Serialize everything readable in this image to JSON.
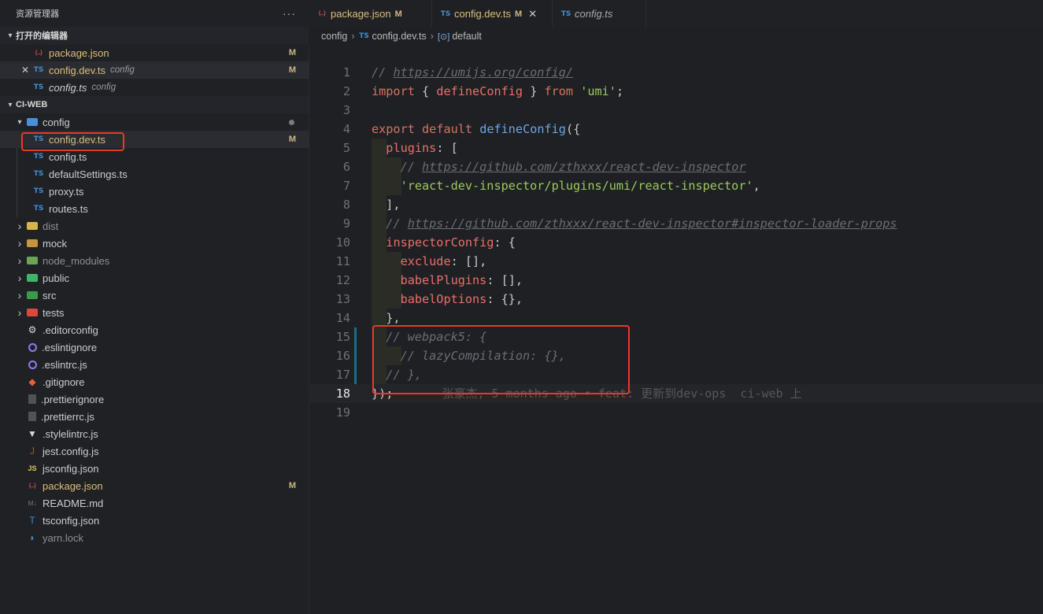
{
  "explorer": {
    "title": "资源管理器",
    "more": "···",
    "open_editors_title": "打开的编辑器",
    "project_title": "CI-WEB",
    "open_editors": [
      {
        "name": "package.json",
        "desc": "",
        "badge": "M",
        "icon": "json-icon",
        "close": ""
      },
      {
        "name": "config.dev.ts",
        "desc": "config",
        "badge": "M",
        "icon": "ts-icon",
        "close": "✕"
      },
      {
        "name": "config.ts",
        "desc": "config",
        "badge": "",
        "icon": "ts-icon",
        "close": ""
      }
    ],
    "tree": [
      {
        "name": "config",
        "type": "folder",
        "open": true,
        "icon_color": "#4a90d9",
        "status": "dot"
      },
      {
        "name": "config.dev.ts",
        "type": "ts",
        "badge": "M"
      },
      {
        "name": "config.ts",
        "type": "ts"
      },
      {
        "name": "defaultSettings.ts",
        "type": "ts"
      },
      {
        "name": "proxy.ts",
        "type": "ts"
      },
      {
        "name": "routes.ts",
        "type": "ts"
      },
      {
        "name": "dist",
        "type": "folder",
        "icon_color": "#d9b44a"
      },
      {
        "name": "mock",
        "type": "folder",
        "icon_color": "#c7953f"
      },
      {
        "name": "node_modules",
        "type": "folder",
        "icon_color": "#6ea45a"
      },
      {
        "name": "public",
        "type": "folder",
        "icon_color": "#3fb56a"
      },
      {
        "name": "src",
        "type": "folder",
        "icon_color": "#3a9a4a"
      },
      {
        "name": "tests",
        "type": "folder",
        "icon_color": "#d94a3a"
      },
      {
        "name": ".editorconfig",
        "type": "file"
      },
      {
        "name": ".eslintignore",
        "type": "file"
      },
      {
        "name": ".eslintrc.js",
        "type": "file"
      },
      {
        "name": ".gitignore",
        "type": "file"
      },
      {
        "name": ".prettierignore",
        "type": "file"
      },
      {
        "name": ".prettierrc.js",
        "type": "file"
      },
      {
        "name": ".stylelintrc.js",
        "type": "file"
      },
      {
        "name": "jest.config.js",
        "type": "file"
      },
      {
        "name": "jsconfig.json",
        "type": "js"
      },
      {
        "name": "package.json",
        "type": "json",
        "badge": "M"
      },
      {
        "name": "README.md",
        "type": "file"
      },
      {
        "name": "tsconfig.json",
        "type": "file"
      },
      {
        "name": "yarn.lock",
        "type": "file"
      }
    ]
  },
  "tabs": [
    {
      "label": "package.json",
      "icon": "json-icon",
      "modified": "M",
      "active": false,
      "italic": false
    },
    {
      "label": "config.dev.ts",
      "icon": "ts-icon",
      "modified": "M",
      "active": true,
      "italic": false,
      "close": "✕"
    },
    {
      "label": "config.ts",
      "icon": "ts-icon",
      "modified": "",
      "active": false,
      "italic": true
    }
  ],
  "icons": {
    "ts": "TS",
    "js": "JS",
    "json": "{...}"
  },
  "breadcrumb": {
    "folder": "config",
    "file": "config.dev.ts",
    "symbol_icon": "[⊙]",
    "symbol": "default"
  },
  "editor": {
    "blame": "张豪杰, 5 months ago • feat: 更新到dev-ops  ci-web 上",
    "lines": [
      {
        "n": "1",
        "tokens": [
          [
            "c-comment",
            "// "
          ],
          [
            "c-comment c-url",
            "https://umijs.org/config/"
          ]
        ]
      },
      {
        "n": "2",
        "tokens": [
          [
            "c-kw",
            "import"
          ],
          [
            "c-punc",
            " { "
          ],
          [
            "c-prop",
            "defineConfig"
          ],
          [
            "c-punc",
            " } "
          ],
          [
            "c-kw",
            "from"
          ],
          [
            "c-punc",
            " "
          ],
          [
            "c-str",
            "'umi'"
          ],
          [
            "c-punc",
            ";"
          ]
        ]
      },
      {
        "n": "3",
        "tokens": []
      },
      {
        "n": "4",
        "tokens": [
          [
            "c-kw",
            "export"
          ],
          [
            "c-punc",
            " "
          ],
          [
            "c-kw",
            "default"
          ],
          [
            "c-punc",
            " "
          ],
          [
            "c-fn",
            "defineConfig"
          ],
          [
            "c-punc",
            "({"
          ]
        ]
      },
      {
        "n": "5",
        "tokens": [
          [
            "c-punc",
            "  "
          ],
          [
            "c-prop",
            "plugins"
          ],
          [
            "c-punc",
            ": ["
          ]
        ]
      },
      {
        "n": "6",
        "tokens": [
          [
            "c-punc",
            "    "
          ],
          [
            "c-comment",
            "// "
          ],
          [
            "c-comment c-url",
            "https://github.com/zthxxx/react-dev-inspector"
          ]
        ]
      },
      {
        "n": "7",
        "tokens": [
          [
            "c-punc",
            "    "
          ],
          [
            "c-str",
            "'react-dev-inspector/plugins/umi/react-inspector'"
          ],
          [
            "c-punc",
            ","
          ]
        ]
      },
      {
        "n": "8",
        "tokens": [
          [
            "c-punc",
            "  ],"
          ]
        ]
      },
      {
        "n": "9",
        "tokens": [
          [
            "c-punc",
            "  "
          ],
          [
            "c-comment",
            "// "
          ],
          [
            "c-comment c-url",
            "https://github.com/zthxxx/react-dev-inspector#inspector-loader-props"
          ]
        ]
      },
      {
        "n": "10",
        "tokens": [
          [
            "c-punc",
            "  "
          ],
          [
            "c-prop",
            "inspectorConfig"
          ],
          [
            "c-punc",
            ": {"
          ]
        ]
      },
      {
        "n": "11",
        "tokens": [
          [
            "c-punc",
            "    "
          ],
          [
            "c-prop",
            "exclude"
          ],
          [
            "c-punc",
            ": [],"
          ]
        ]
      },
      {
        "n": "12",
        "tokens": [
          [
            "c-punc",
            "    "
          ],
          [
            "c-prop",
            "babelPlugins"
          ],
          [
            "c-punc",
            ": [],"
          ]
        ]
      },
      {
        "n": "13",
        "tokens": [
          [
            "c-punc",
            "    "
          ],
          [
            "c-prop",
            "babelOptions"
          ],
          [
            "c-punc",
            ": {},"
          ]
        ]
      },
      {
        "n": "14",
        "tokens": [
          [
            "c-punc",
            "  },"
          ]
        ]
      },
      {
        "n": "15",
        "tokens": [
          [
            "c-punc",
            "  "
          ],
          [
            "c-comment",
            "// webpack5: {"
          ]
        ]
      },
      {
        "n": "16",
        "tokens": [
          [
            "c-punc",
            "    "
          ],
          [
            "c-comment",
            "// lazyCompilation: {},"
          ]
        ]
      },
      {
        "n": "17",
        "tokens": [
          [
            "c-punc",
            "  "
          ],
          [
            "c-comment",
            "// },"
          ]
        ]
      },
      {
        "n": "18",
        "tokens": [
          [
            "c-punc",
            "});"
          ]
        ]
      },
      {
        "n": "19",
        "tokens": []
      }
    ]
  }
}
